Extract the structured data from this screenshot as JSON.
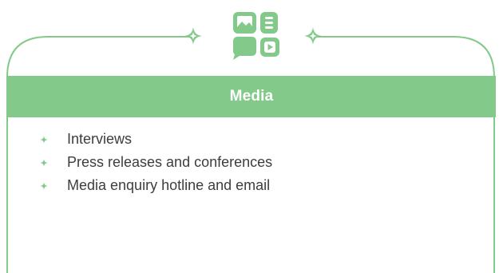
{
  "colors": {
    "accent": "#82c98a",
    "outline": "#82c98a",
    "text": "#3d3d3d",
    "header_text": "#ffffff"
  },
  "icons": {
    "top": "media-icon",
    "decor": "sparkle-icon",
    "bullet": "diamond-bullet-icon"
  },
  "section": {
    "title": "Media",
    "items": [
      "Interviews",
      "Press releases and conferences",
      "Media enquiry hotline and email"
    ]
  }
}
